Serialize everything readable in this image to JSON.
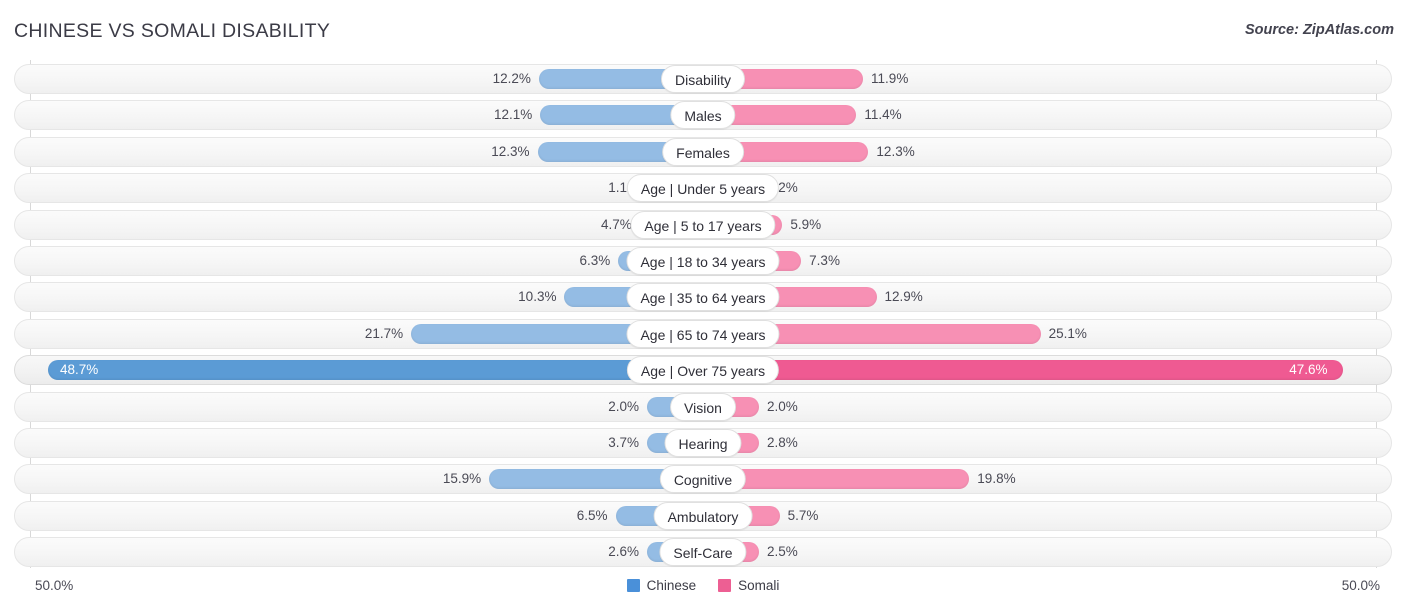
{
  "header": {
    "title": "CHINESE VS SOMALI DISABILITY",
    "source": "Source: ZipAtlas.com"
  },
  "footer": {
    "left_axis_label": "50.0%",
    "right_axis_label": "50.0%",
    "legend": [
      {
        "label": "Chinese",
        "color": "#4a90d9"
      },
      {
        "label": "Somali",
        "color": "#ed5f93"
      }
    ]
  },
  "colors": {
    "left_bar": "#94bce4",
    "right_bar": "#f790b4",
    "left_bar_highlight": "#5b9bd5",
    "right_bar_highlight": "#ef5a92"
  },
  "chart_data": {
    "type": "bar",
    "title": "CHINESE VS SOMALI DISABILITY",
    "subtitle": "Source: ZipAtlas.com",
    "orientation": "horizontal-diverging",
    "xlabel": "",
    "ylabel": "",
    "xlim": [
      50.0,
      50.0
    ],
    "grid": false,
    "legend_position": "bottom-center",
    "categories": [
      "Disability",
      "Males",
      "Females",
      "Age | Under 5 years",
      "Age | 5 to 17 years",
      "Age | 18 to 34 years",
      "Age | 35 to 64 years",
      "Age | 65 to 74 years",
      "Age | Over 75 years",
      "Vision",
      "Hearing",
      "Cognitive",
      "Ambulatory",
      "Self-Care"
    ],
    "series": [
      {
        "name": "Chinese",
        "color": "#4a90d9",
        "values": [
          12.2,
          12.1,
          12.3,
          1.1,
          4.7,
          6.3,
          10.3,
          21.7,
          48.7,
          2.0,
          3.7,
          15.9,
          6.5,
          2.6
        ]
      },
      {
        "name": "Somali",
        "color": "#ed5f93",
        "values": [
          11.9,
          11.4,
          12.3,
          1.2,
          5.9,
          7.3,
          12.9,
          25.1,
          47.6,
          2.0,
          2.8,
          19.8,
          5.7,
          2.5
        ]
      }
    ],
    "value_labels": {
      "Chinese": [
        "12.2%",
        "12.1%",
        "12.3%",
        "1.1%",
        "4.7%",
        "6.3%",
        "10.3%",
        "21.7%",
        "48.7%",
        "2.0%",
        "3.7%",
        "15.9%",
        "6.5%",
        "2.6%"
      ],
      "Somali": [
        "11.9%",
        "11.4%",
        "12.3%",
        "1.2%",
        "5.9%",
        "7.3%",
        "12.9%",
        "25.1%",
        "47.6%",
        "2.0%",
        "2.8%",
        "19.8%",
        "5.7%",
        "2.5%"
      ]
    },
    "highlighted_row": "Age | Over 75 years"
  }
}
